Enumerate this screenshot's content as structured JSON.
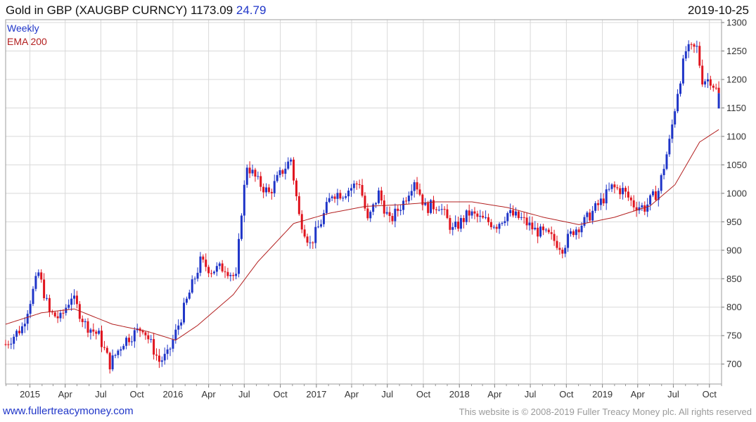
{
  "header": {
    "title": "Gold in GBP (XAUGBP CURNCY) 1173.09",
    "change": "24.79",
    "date": "2019-10-25"
  },
  "legend": {
    "period": "Weekly",
    "ema": "EMA 200"
  },
  "footer": {
    "site": "www.fullertreacymoney.com",
    "copyright": "This website is © 2008-2019 Fuller Treacy Money plc. All rights reserved"
  },
  "colors": {
    "up": "#1f35c8",
    "down": "#e0141e",
    "ema": "#b32020",
    "grid": "#d9d9d9",
    "accent": "#1f35c8"
  },
  "chart_data": {
    "type": "candlestick",
    "frequency": "weekly",
    "ylim": [
      665,
      1305
    ],
    "y_ticks": [
      700,
      750,
      800,
      850,
      900,
      950,
      1000,
      1050,
      1100,
      1150,
      1200,
      1250,
      1300
    ],
    "x_ticks": [
      "2015",
      "Apr",
      "Jul",
      "Oct",
      "2016",
      "Apr",
      "Jul",
      "Oct",
      "2017",
      "Apr",
      "Jul",
      "Oct",
      "2018",
      "Apr",
      "Jul",
      "Oct",
      "2019",
      "Apr",
      "Jul",
      "Oct"
    ],
    "x_range": [
      "2014-10-31",
      "2019-11-01"
    ],
    "last_close": 1173.09,
    "price_anchors": [
      [
        "2014-10-31",
        735
      ],
      [
        "2014-12-12",
        765
      ],
      [
        "2015-01-23",
        860
      ],
      [
        "2015-02-20",
        790
      ],
      [
        "2015-03-20",
        780
      ],
      [
        "2015-04-17",
        820
      ],
      [
        "2015-05-22",
        770
      ],
      [
        "2015-06-26",
        750
      ],
      [
        "2015-07-24",
        700
      ],
      [
        "2015-08-28",
        740
      ],
      [
        "2015-10-16",
        765
      ],
      [
        "2015-11-27",
        705
      ],
      [
        "2015-12-18",
        715
      ],
      [
        "2016-01-08",
        755
      ],
      [
        "2016-02-12",
        825
      ],
      [
        "2016-03-11",
        880
      ],
      [
        "2016-04-08",
        865
      ],
      [
        "2016-05-13",
        870
      ],
      [
        "2016-06-10",
        850
      ],
      [
        "2016-06-24",
        970
      ],
      [
        "2016-07-08",
        1050
      ],
      [
        "2016-08-05",
        1020
      ],
      [
        "2016-09-02",
        1000
      ],
      [
        "2016-10-07",
        1040
      ],
      [
        "2016-10-28",
        1060
      ],
      [
        "2016-11-18",
        960
      ],
      [
        "2016-12-16",
        910
      ],
      [
        "2017-01-13",
        950
      ],
      [
        "2017-02-10",
        1000
      ],
      [
        "2017-03-10",
        1000
      ],
      [
        "2017-04-21",
        1020
      ],
      [
        "2017-05-12",
        950
      ],
      [
        "2017-06-09",
        1000
      ],
      [
        "2017-07-07",
        950
      ],
      [
        "2017-08-11",
        985
      ],
      [
        "2017-09-08",
        1025
      ],
      [
        "2017-10-06",
        975
      ],
      [
        "2017-11-10",
        980
      ],
      [
        "2017-12-15",
        935
      ],
      [
        "2018-01-26",
        965
      ],
      [
        "2018-02-23",
        955
      ],
      [
        "2018-04-06",
        945
      ],
      [
        "2018-05-04",
        965
      ],
      [
        "2018-06-08",
        955
      ],
      [
        "2018-07-13",
        935
      ],
      [
        "2018-08-17",
        925
      ],
      [
        "2018-09-21",
        905
      ],
      [
        "2018-10-19",
        935
      ],
      [
        "2018-11-16",
        950
      ],
      [
        "2018-12-28",
        985
      ],
      [
        "2019-01-25",
        1010
      ],
      [
        "2019-02-22",
        1005
      ],
      [
        "2019-03-22",
        980
      ],
      [
        "2019-04-19",
        975
      ],
      [
        "2019-05-24",
        1005
      ],
      [
        "2019-06-21",
        1090
      ],
      [
        "2019-07-12",
        1180
      ],
      [
        "2019-08-02",
        1250
      ],
      [
        "2019-08-30",
        1255
      ],
      [
        "2019-09-13",
        1200
      ],
      [
        "2019-10-04",
        1200
      ],
      [
        "2019-10-25",
        1173
      ]
    ],
    "ema_anchors": [
      [
        "2014-10-31",
        770
      ],
      [
        "2015-01-30",
        790
      ],
      [
        "2015-04-24",
        797
      ],
      [
        "2015-07-31",
        770
      ],
      [
        "2015-10-30",
        757
      ],
      [
        "2016-01-08",
        742
      ],
      [
        "2016-03-04",
        768
      ],
      [
        "2016-06-03",
        822
      ],
      [
        "2016-08-05",
        880
      ],
      [
        "2016-11-04",
        947
      ],
      [
        "2017-02-03",
        965
      ],
      [
        "2017-05-05",
        977
      ],
      [
        "2017-08-04",
        980
      ],
      [
        "2017-11-03",
        985
      ],
      [
        "2018-02-02",
        985
      ],
      [
        "2018-05-04",
        975
      ],
      [
        "2018-08-03",
        958
      ],
      [
        "2018-11-02",
        945
      ],
      [
        "2019-02-01",
        958
      ],
      [
        "2019-05-03",
        978
      ],
      [
        "2019-07-05",
        1015
      ],
      [
        "2019-09-06",
        1090
      ],
      [
        "2019-10-25",
        1112
      ]
    ]
  }
}
